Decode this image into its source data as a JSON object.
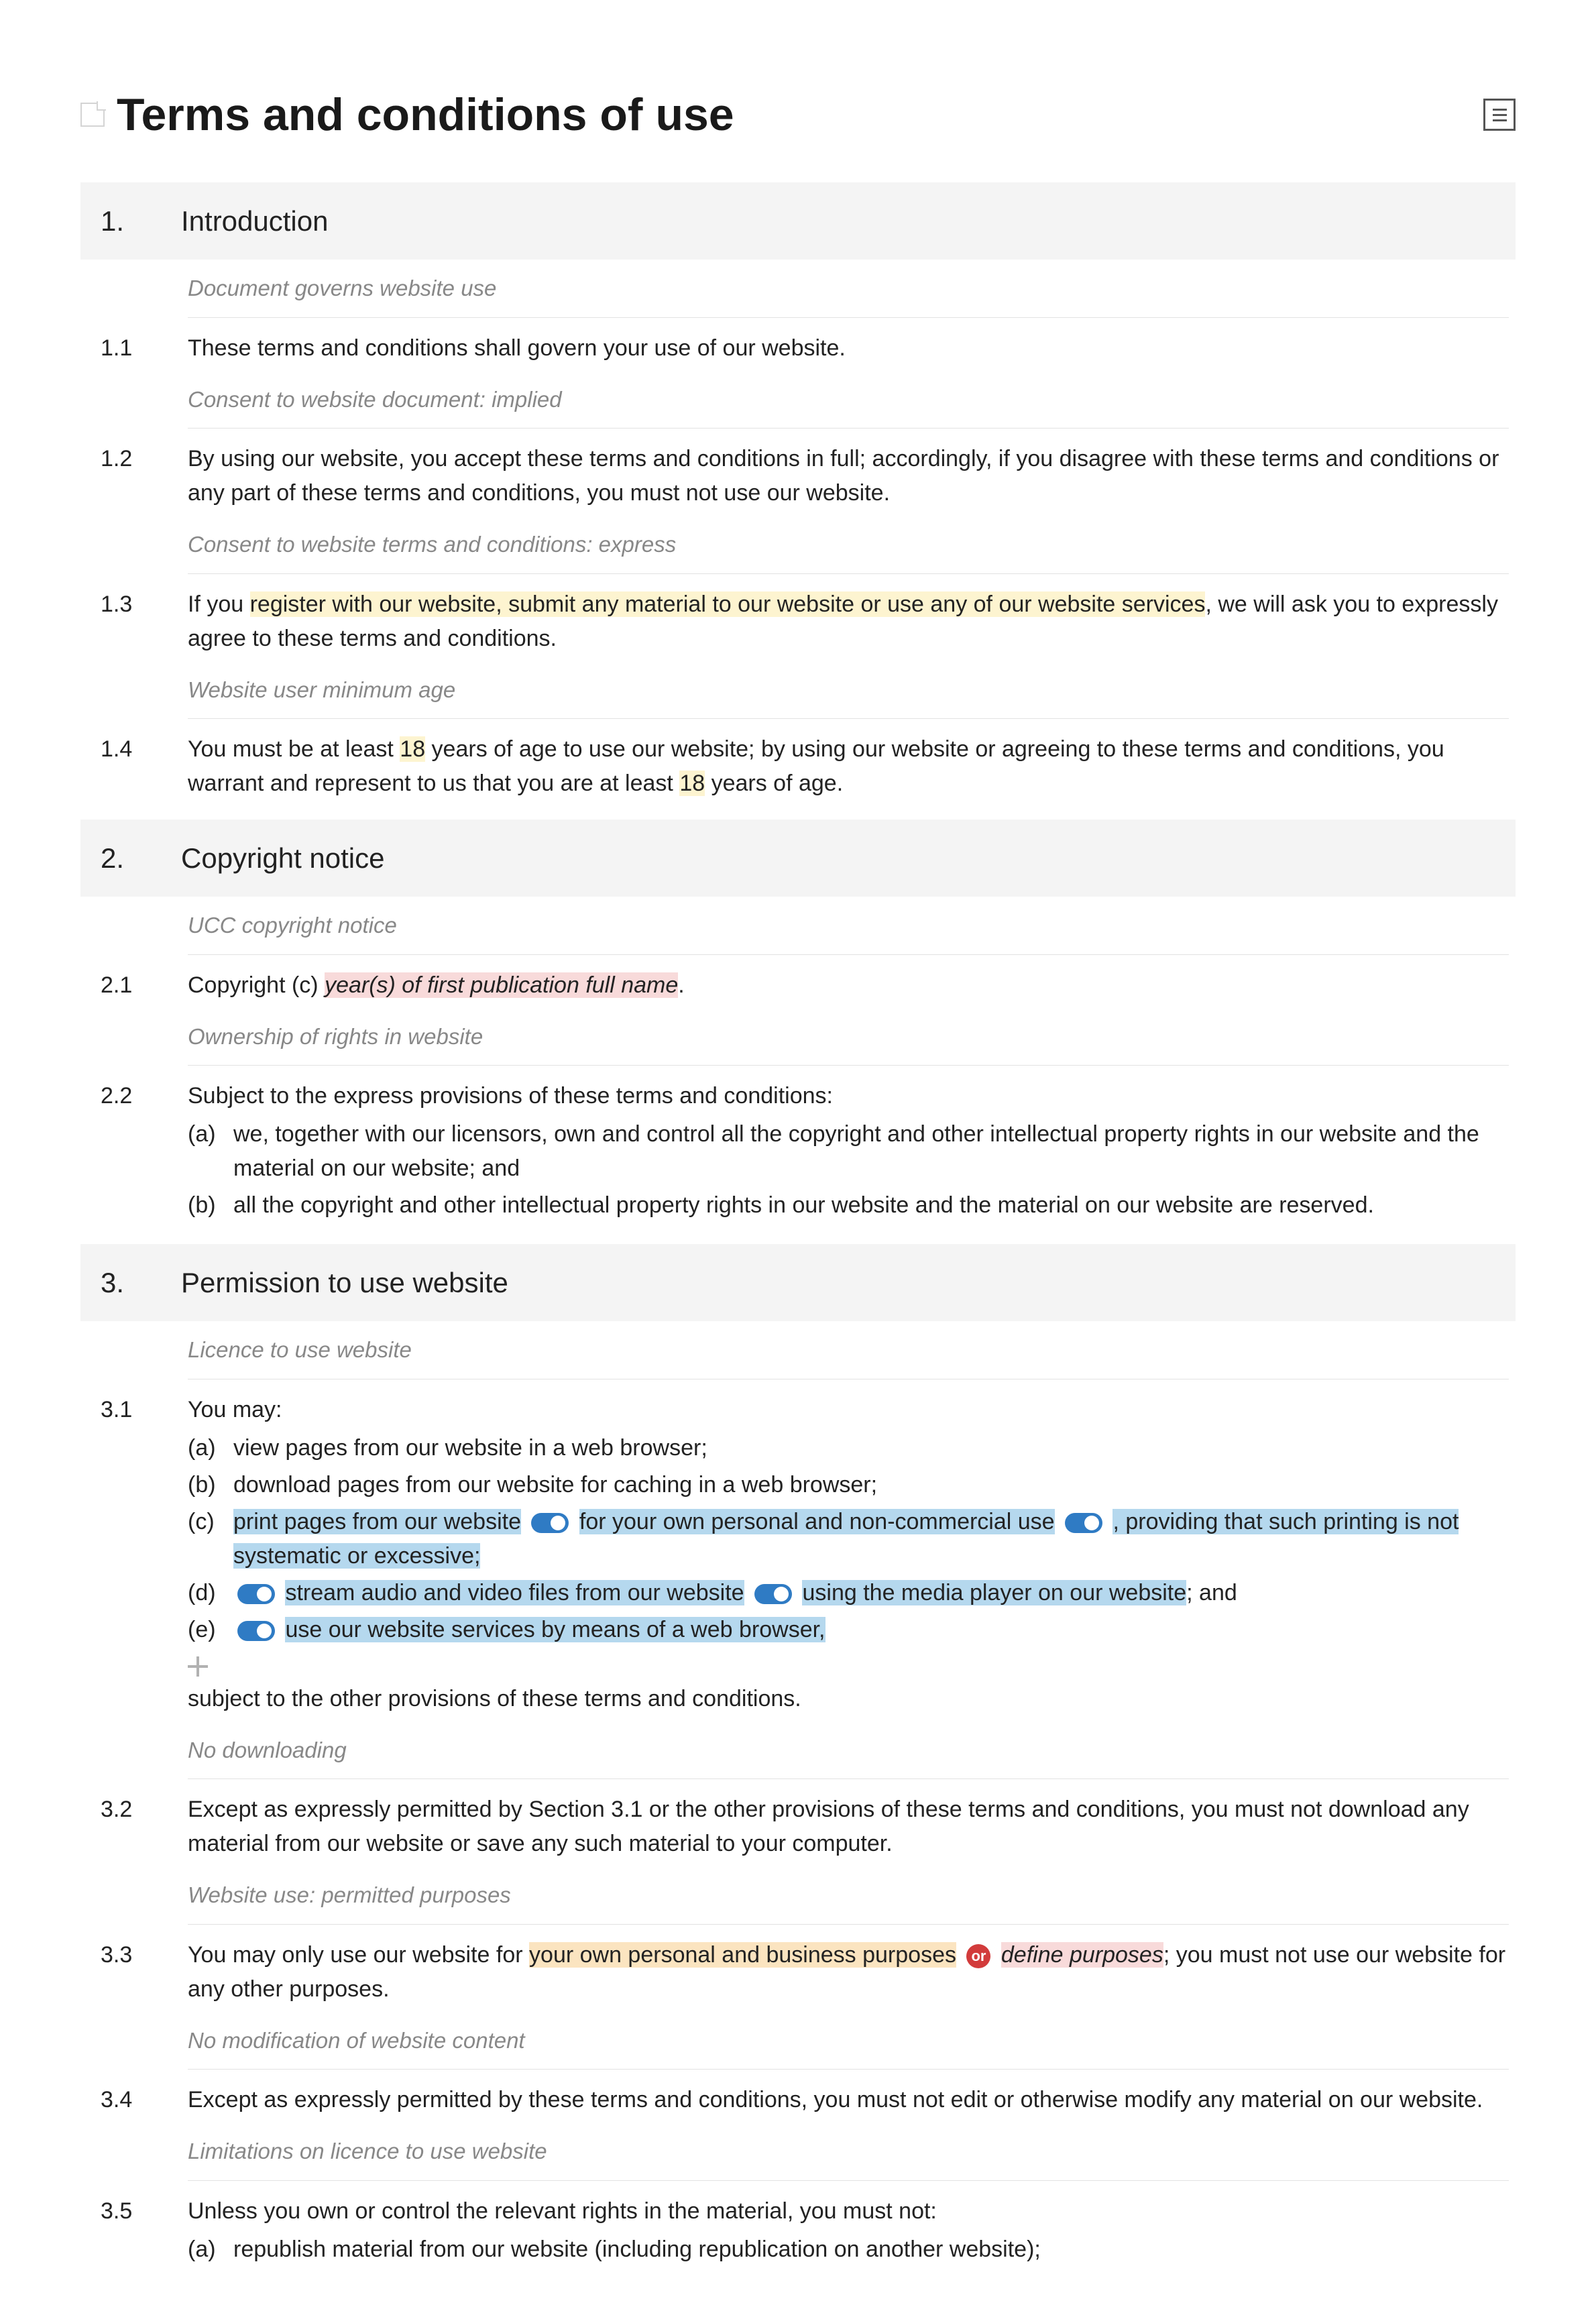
{
  "page_title": "Terms and conditions of use",
  "sections": {
    "s1": {
      "num": "1.",
      "title": "Introduction"
    },
    "s2": {
      "num": "2.",
      "title": "Copyright notice"
    },
    "s3": {
      "num": "3.",
      "title": "Permission to use website"
    }
  },
  "notes": {
    "n1_1": "Document governs website use",
    "n1_2": "Consent to website document: implied",
    "n1_3": "Consent to website terms and conditions: express",
    "n1_4": "Website user minimum age",
    "n2_1": "UCC copyright notice",
    "n2_2": "Ownership of rights in website",
    "n3_1": "Licence to use website",
    "n3_2": "No downloading",
    "n3_3": "Website use: permitted purposes",
    "n3_4": "No modification of website content",
    "n3_5": "Limitations on licence to use website"
  },
  "clauses": {
    "c1_1": {
      "num": "1.1",
      "text": "These terms and conditions shall govern your use of our website."
    },
    "c1_2": {
      "num": "1.2",
      "text": "By using our website, you accept these terms and conditions in full; accordingly, if you disagree with these terms and conditions or any part of these terms and conditions, you must not use our website."
    },
    "c1_3": {
      "num": "1.3",
      "pre": "If you ",
      "hl": "register with our website, submit any material to our website or use any of our website services",
      "post": ", we will ask you to expressly agree to these terms and conditions."
    },
    "c1_4": {
      "num": "1.4",
      "pre": "You must be at least ",
      "hl": "18",
      "mid": " years of age to use our website; by using our website or agreeing to these terms and conditions, you warrant and represent to us that you are at least ",
      "hl2": "18",
      "post": " years of age."
    },
    "c2_1": {
      "num": "2.1",
      "pre": "Copyright (c) ",
      "ph": "year(s) of first publication full name",
      "post": "."
    },
    "c2_2": {
      "num": "2.2",
      "intro": "Subject to the express provisions of these terms and conditions:",
      "a_label": "(a)",
      "a_text": "we, together with our licensors, own and control all the copyright and other intellectual property rights in our website and the material on our website; and",
      "b_label": "(b)",
      "b_text": "all the copyright and other intellectual property rights in our website and the material on our website are reserved."
    },
    "c3_1": {
      "num": "3.1",
      "intro": "You may:",
      "a_label": "(a)",
      "a_text": "view pages from our website in a web browser;",
      "b_label": "(b)",
      "b_text": "download pages from our website for caching in a web browser;",
      "c_label": "(c)",
      "c_pre": "print pages from our website",
      "c_mid1": " for your own personal and non-commercial use",
      "c_mid2": ", providing that such printing is not systematic or excessive;",
      "d_label": "(d)",
      "d_mid1": "stream audio and video files from our website",
      "d_mid2": " using the media player on our website",
      "d_post": "; and",
      "e_label": "(e)",
      "e_text": "use our website services by means of a web browser,",
      "tail": "subject to the other provisions of these terms and conditions."
    },
    "c3_2": {
      "num": "3.2",
      "text": "Except as expressly permitted by Section 3.1 or the other provisions of these terms and conditions, you must not download any material from our website or save any such material to your computer."
    },
    "c3_3": {
      "num": "3.3",
      "pre": "You may only use our website for ",
      "opt1": "your own personal and business purposes",
      "or": "or",
      "opt2": "define purposes",
      "post": "; you must not use our website for any other purposes."
    },
    "c3_4": {
      "num": "3.4",
      "text": "Except as expressly permitted by these terms and conditions, you must not edit or otherwise modify any material on our website."
    },
    "c3_5": {
      "num": "3.5",
      "intro": "Unless you own or control the relevant rights in the material, you must not:",
      "a_label": "(a)",
      "a_text": "republish material from our website (including republication on another website);"
    }
  }
}
